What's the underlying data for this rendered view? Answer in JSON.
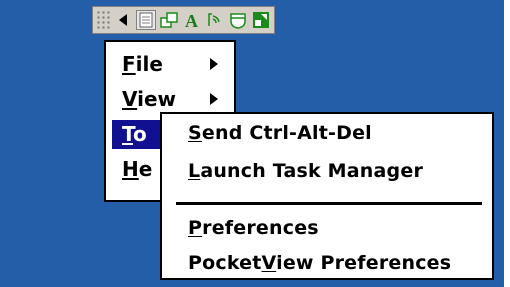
{
  "toolbar": {
    "buttons": [
      {
        "icon": "grip-icon"
      },
      {
        "icon": "left-arrow-icon"
      },
      {
        "icon": "document-icon"
      },
      {
        "icon": "windows-icon"
      },
      {
        "icon": "font-a-icon"
      },
      {
        "icon": "wireless-icon"
      },
      {
        "icon": "shield-icon"
      },
      {
        "icon": "expand-icon"
      }
    ],
    "colors": {
      "accent": "#101090",
      "desktop": "#245ea9"
    }
  },
  "main_menu": {
    "items": [
      {
        "mnemonic": "F",
        "rest": "ile",
        "has_submenu": true
      },
      {
        "mnemonic": "V",
        "rest": "iew",
        "has_submenu": true
      },
      {
        "mnemonic": "T",
        "rest": "o",
        "has_submenu": true,
        "selected": true
      },
      {
        "mnemonic": "H",
        "rest": "e",
        "has_submenu": false
      }
    ]
  },
  "sub_menu": {
    "items": [
      {
        "pre": "",
        "mnemonic": "S",
        "post": "end Ctrl-Alt-Del"
      },
      {
        "pre": "",
        "mnemonic": "L",
        "post": "aunch Task Manager"
      },
      {
        "pre": "",
        "mnemonic": "P",
        "post": "references"
      },
      {
        "pre": "Pocket",
        "mnemonic": "V",
        "post": "iew Preferences"
      }
    ]
  }
}
